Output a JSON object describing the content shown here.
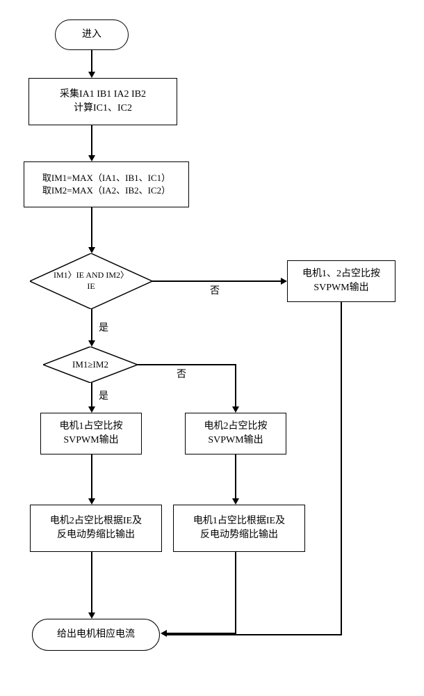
{
  "nodes": {
    "start": "进入",
    "collect": {
      "line1": "采集IA1 IB1 IA2 IB2",
      "line2": "计算IC1、IC2"
    },
    "takemax": {
      "line1": "取IM1=MAX（IA1、IB1、IC1）",
      "line2": "取IM2=MAX（IA2、IB2、IC2）"
    },
    "dec1": {
      "line1": "IM1〉IE AND IM2〉",
      "line2": "IE"
    },
    "dec2": "IM1≥IM2",
    "both_svpwm": {
      "line1": "电机1、2占空比按",
      "line2": "SVPWM输出"
    },
    "m1_svpwm": {
      "line1": "电机1占空比按",
      "line2": "SVPWM输出"
    },
    "m2_svpwm": {
      "line1": "电机2占空比按",
      "line2": "SVPWM输出"
    },
    "m2_scale": {
      "line1": "电机2占空比根据IE及",
      "line2": "反电动势缩比输出"
    },
    "m1_scale": {
      "line1": "电机1占空比根据IE及",
      "line2": "反电动势缩比输出"
    },
    "end": "给出电机相应电流"
  },
  "labels": {
    "yes": "是",
    "no": "否"
  }
}
